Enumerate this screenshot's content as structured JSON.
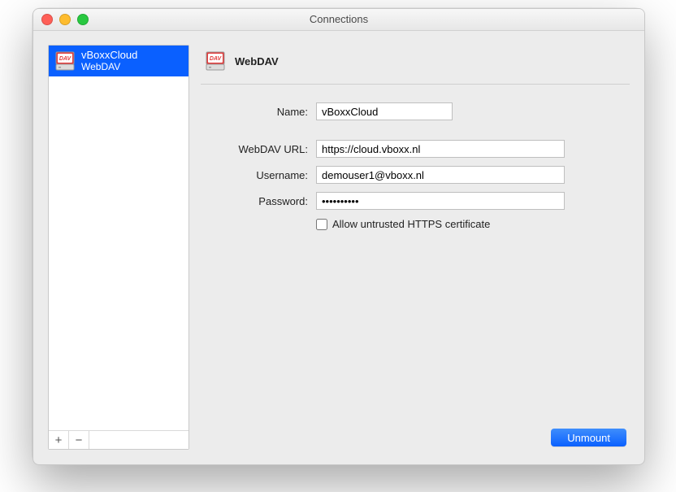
{
  "window": {
    "title": "Connections"
  },
  "sidebar": {
    "items": [
      {
        "title": "vBoxxCloud",
        "subtitle": "WebDAV"
      }
    ],
    "add_label": "+",
    "remove_label": "−"
  },
  "detail": {
    "protocol_label": "WebDAV",
    "fields": {
      "name": {
        "label": "Name:",
        "value": "vBoxxCloud"
      },
      "url": {
        "label": "WebDAV URL:",
        "value": "https://cloud.vboxx.nl"
      },
      "username": {
        "label": "Username:",
        "value": "demouser1@vboxx.nl"
      },
      "password": {
        "label": "Password:",
        "value": "••••••••••"
      }
    },
    "allow_untrusted_label": "Allow untrusted HTTPS certificate",
    "allow_untrusted_checked": false,
    "unmount_label": "Unmount"
  },
  "icons": {
    "dav_badge_text": "DAV"
  },
  "colors": {
    "selection": "#0a60ff",
    "primary_button": "#0a60ff",
    "dav_red": "#e23b3b"
  }
}
